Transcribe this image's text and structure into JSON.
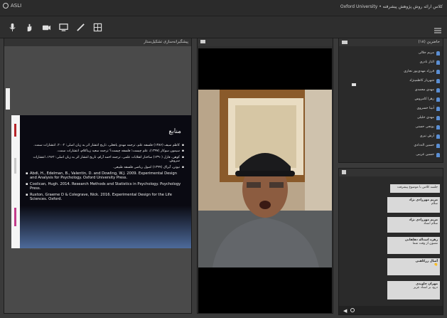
{
  "topbar": {
    "app_name": "ASLI",
    "title": "کلاس ارائه روش پژوهش پیشرفته • Oxford University"
  },
  "toolbar": {
    "icons": [
      "microphone-icon",
      "hand-icon",
      "camera-icon",
      "monitor-icon",
      "pen-icon",
      "grid-icon"
    ]
  },
  "document_pod": {
    "title": "پیشگیرانه‌سازی تشکیل‌ستار"
  },
  "slide": {
    "title": "منابع",
    "items": [
      {
        "text": "کاظم سیف (۱۳۸۶) فلسفه علم، ترجمه مهدی یافعلی، تاریخ انتشار اثر به زبان اصلی: ۲۰۰۲، انتشارات سمت.",
        "dir": "rtl"
      },
      {
        "text": "سیمون سوکار (۱۳۹۷)، علم چیست؛ فلسفه چیست؟ ترجمه سعید زیباکلام، انتشارات سمت.",
        "dir": "rtl"
      },
      {
        "text": "کوهن، فارل (۱۳۹۰) ساختار انقلابات علمی، ترجمه احمد آرام، تاریخ انتشار اثر به زبان اصلی: ۱۹۶۲، انتشارات سروش.",
        "dir": "rtl"
      },
      {
        "text": "نیوتن، آیزاک (۱۳۹۹) اصول ریاضی فلسفه طبیعی.",
        "dir": "rtl"
      },
      {
        "text": "Abdi, H., Edelman, B., Valentin, D. and Dowling, W.J. 2009. Experimental Design and Analysis for Psychology. Oxford University Press.",
        "dir": "ltr"
      },
      {
        "text": "Coolican, Hugh. 2014. Research Methods and Statistics in Psychology. Psychology Press.",
        "dir": "ltr"
      },
      {
        "text": "Ruxton, Graeme D & Colegrave, Nick. 2016. Experimental Design for the Life Sciences. Oxford.",
        "dir": "ltr"
      }
    ]
  },
  "video_pod": {
    "title": ""
  },
  "attendees": {
    "title": "حاضرین (۱۸)",
    "users": [
      "مریم جلالی",
      "الناز نادری",
      "فرزاد مهدی‌پور نجاری",
      "شهریار کاظمینژاد",
      "مهدی محمدی",
      "زهرا کامروس",
      "آنیتا خسروی",
      "مهدی خلیلی",
      "پونجی حسنی",
      "آرش نیری",
      "حسین اله‌دادی",
      "حسین غریبی"
    ]
  },
  "chat": {
    "title": "",
    "messages": [
      {
        "name": "",
        "text": "جلسه کلاس با موضوع پیشرفت"
      },
      {
        "name": "مریم مهرزادی نژاد",
        "text": "سلام"
      },
      {
        "name": "مریم مهرزادی نژاد",
        "text": "سلام استاد"
      },
      {
        "name": "زهره اسداله دهلقانی",
        "text": "ممنون از وقت شما"
      },
      {
        "name": "آسال زرکاهنی",
        "text": "👏"
      },
      {
        "name": "مهران جاویدی",
        "text": "درود بر استاد عزیز"
      }
    ]
  },
  "colors": {
    "background": "#3a3a3a",
    "user_icon": "#5b8fd4",
    "chat_bubble": "#d9d9d9"
  }
}
